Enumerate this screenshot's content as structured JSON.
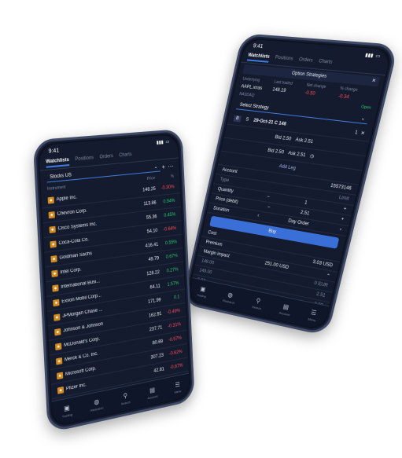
{
  "back_phone": {
    "time": "9:41",
    "tabs": [
      "Watchlists",
      "Positions",
      "Orders",
      "Charts"
    ],
    "panel_title": "Option Strategies",
    "underlying_label": "Underlying",
    "underlying_value": "AAPL.xnas",
    "last_traded_label": "Last traded",
    "last_traded_value": "148.19",
    "net_change_label": "Net change",
    "net_change_value": "-0.50",
    "pct_change_label": "% change",
    "pct_change_value": "-0.34",
    "market_label": "NASDAQ",
    "open_label": "Open",
    "select_strategy": "Select Strategy",
    "leg": {
      "buy": "B",
      "sell": "S",
      "contract": "29-Oct-21 C 148",
      "qty": "1"
    },
    "bid_label_1": "Bid 2.50",
    "ask_label_1": "Ask 2.51",
    "bid_label_2": "Bid 2.50",
    "ask_label_2": "Ask 2.51",
    "add_leg": "Add Leg",
    "account_label": "Account",
    "account_value": "15573146",
    "type_label": "Type",
    "type_value": "Limit",
    "quantity_label": "Quantity",
    "quantity_value": "1",
    "price_label": "Price (debit)",
    "price_value": "2.51",
    "duration_label": "Duration",
    "duration_value": "Day Order",
    "buy_button": "Buy",
    "cost_label": "Cost",
    "premium_label": "Premium",
    "premium_value": "3.03 USD",
    "margin_label": "Margin impact",
    "margin_value": "251.00 USD",
    "bg_values": [
      "148.00",
      "149.00",
      "2.02",
      "2.51",
      "0 EUR",
      "2.03"
    ],
    "nav": [
      "Trading",
      "Research",
      "Search",
      "Account",
      "Menu"
    ]
  },
  "front_phone": {
    "time": "9:41",
    "tabs": [
      "Watchlists",
      "Positions",
      "Orders",
      "Charts"
    ],
    "list_selector": "Stocks US",
    "col_instrument": "Instrument",
    "col_price": "Price",
    "col_change": "%",
    "rows": [
      {
        "name": "Apple Inc.",
        "price": "148.25",
        "change": "-0.30%",
        "dir": "neg"
      },
      {
        "name": "Chevron Corp.",
        "price": "113.86",
        "change": "0.94%",
        "dir": "pos"
      },
      {
        "name": "Cisco Systems Inc.",
        "price": "55.36",
        "change": "0.45%",
        "dir": "pos"
      },
      {
        "name": "Coca-Cola Co.",
        "price": "54.10",
        "change": "-0.64%",
        "dir": "neg"
      },
      {
        "name": "Goldman Sachs",
        "price": "416.41",
        "change": "0.55%",
        "dir": "pos"
      },
      {
        "name": "Intel Corp.",
        "price": "49.79",
        "change": "0.67%",
        "dir": "pos"
      },
      {
        "name": "International Busi...",
        "price": "128.22",
        "change": "0.27%",
        "dir": "pos"
      },
      {
        "name": "Exxon Mobil Corp...",
        "price": "64.11",
        "change": "1.57%",
        "dir": "pos"
      },
      {
        "name": "JPMorgan Chase ...",
        "price": "171.99",
        "change": "0.1",
        "dir": "pos"
      },
      {
        "name": "Johnson & Johnson",
        "price": "162.91",
        "change": "-0.49%",
        "dir": "neg"
      },
      {
        "name": "McDonald's Corp.",
        "price": "237.71",
        "change": "-0.31%",
        "dir": "neg"
      },
      {
        "name": "Merck & Co. Inc.",
        "price": "80.69",
        "change": "-0.57%",
        "dir": "neg"
      },
      {
        "name": "Microsoft Corp.",
        "price": "307.23",
        "change": "-0.62%",
        "dir": "neg"
      },
      {
        "name": "Pfizer Inc.",
        "price": "42.81",
        "change": "-0.87%",
        "dir": "neg"
      }
    ],
    "nav": [
      "Trading",
      "Research",
      "Search",
      "Account",
      "Menu"
    ]
  }
}
